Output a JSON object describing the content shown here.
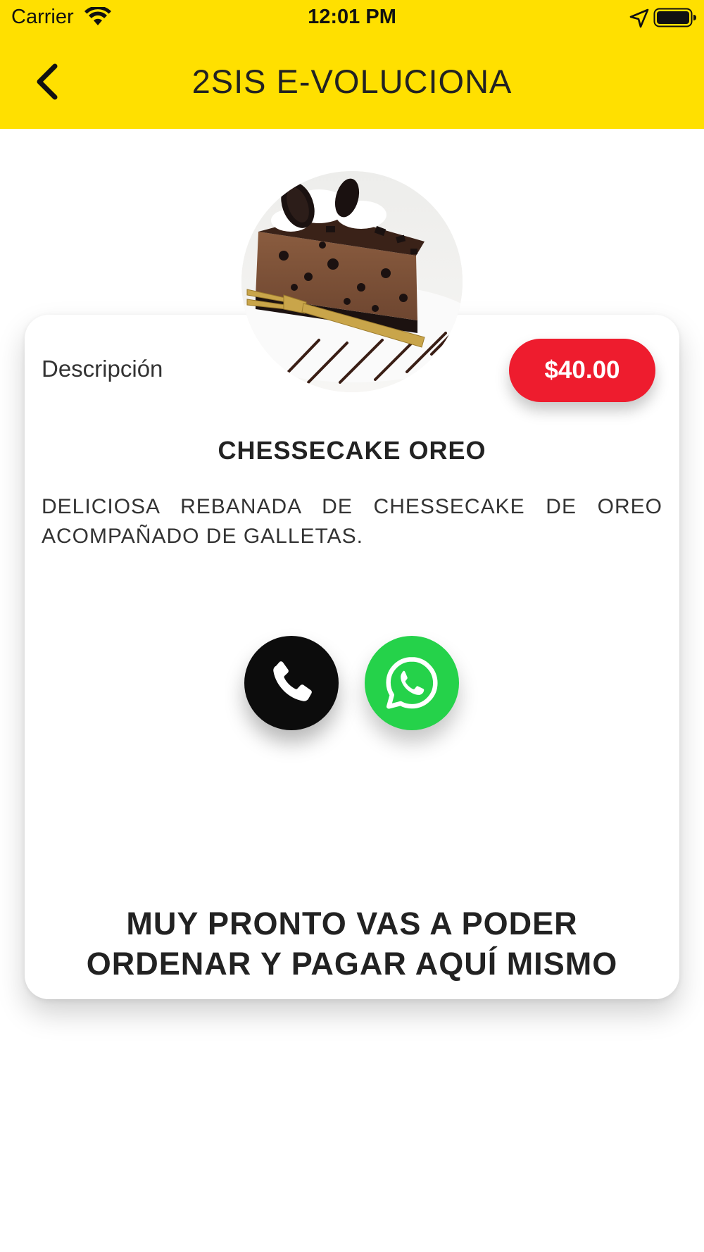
{
  "status_bar": {
    "carrier": "Carrier",
    "time": "12:01 PM"
  },
  "header": {
    "title": "2SIS E-VOLUCIONA",
    "background_color": "#FFE000",
    "back_icon": "chevron-left-icon"
  },
  "product": {
    "image_icon": "cheesecake-slice-image",
    "description_label": "Descripción",
    "price": "$40.00",
    "price_color": "#EE1C2E",
    "name": "CHESSECAKE OREO",
    "description": "DELICIOSA REBANADA DE CHESSECAKE DE OREO ACOMPAÑADO DE GALLETAS."
  },
  "actions": {
    "call_icon": "phone-icon",
    "call_color": "#0c0c0c",
    "whatsapp_icon": "whatsapp-icon",
    "whatsapp_color": "#25D24A"
  },
  "notice": {
    "line1": "MUY PRONTO VAS A PODER",
    "line2": "ORDENAR Y PAGAR AQUÍ MISMO"
  }
}
